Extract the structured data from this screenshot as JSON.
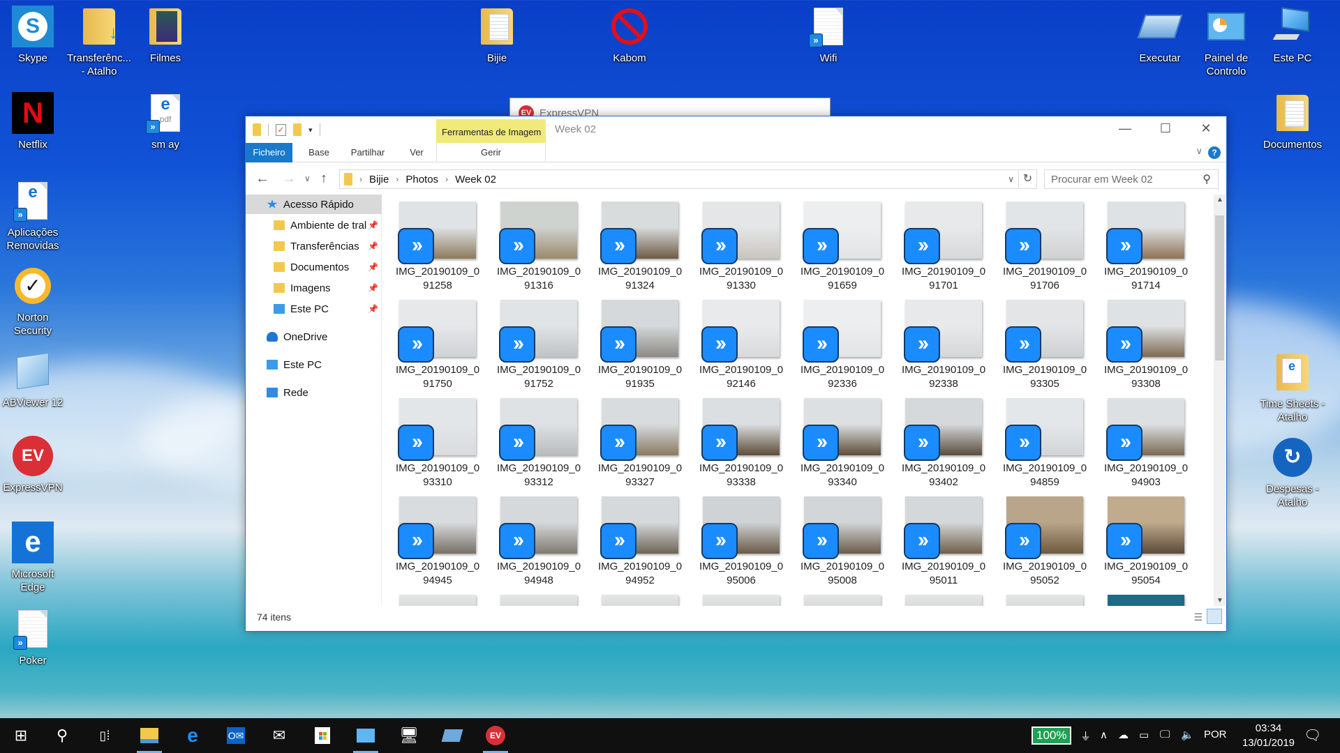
{
  "desktop": {
    "icons": [
      {
        "label": "Skype",
        "icon": "skype-icon"
      },
      {
        "label": "Transferênc... - Atalho",
        "icon": "downloads-folder-icon"
      },
      {
        "label": "Filmes",
        "icon": "videos-folder-icon"
      },
      {
        "label": "Bijie",
        "icon": "folder-icon"
      },
      {
        "label": "Kabom",
        "icon": "prohibited-icon"
      },
      {
        "label": "Wifi",
        "icon": "text-file-shortcut-icon"
      },
      {
        "label": "Executar",
        "icon": "run-icon"
      },
      {
        "label": "Painel de Controlo",
        "icon": "control-panel-icon"
      },
      {
        "label": "Este PC",
        "icon": "computer-icon"
      },
      {
        "label": "Netflix",
        "icon": "netflix-icon"
      },
      {
        "label": "sm ay",
        "icon": "pdf-shortcut-icon"
      },
      {
        "label": "Documentos",
        "icon": "documents-folder-icon"
      },
      {
        "label": "Aplicações Removidas",
        "icon": "edge-document-shortcut-icon"
      },
      {
        "label": "Norton Security",
        "icon": "norton-icon"
      },
      {
        "label": "ABViewer 12",
        "icon": "abviewer-icon"
      },
      {
        "label": "ExpressVPN",
        "icon": "expressvpn-icon"
      },
      {
        "label": "Microsoft Edge",
        "icon": "edge-icon"
      },
      {
        "label": "Poker",
        "icon": "text-file-shortcut-icon"
      },
      {
        "label": "Time Sheets - Atalho",
        "icon": "folder-shortcut-icon"
      },
      {
        "label": "Despesas - Atalho",
        "icon": "expenses-app-icon"
      }
    ]
  },
  "background_window": {
    "title": "ExpressVPN"
  },
  "explorer": {
    "title": "Week 02",
    "context_tab": "Ferramentas de Imagem",
    "context_subtab": "Gerir",
    "ribbon_tabs": [
      "Ficheiro",
      "Base",
      "Partilhar",
      "Ver"
    ],
    "breadcrumb": [
      "Bijie",
      "Photos",
      "Week 02"
    ],
    "search_placeholder": "Procurar em Week 02",
    "nav_pane": [
      {
        "label": "Acesso Rápido",
        "pinned": false,
        "selected": true
      },
      {
        "label": "Ambiente de tral",
        "pinned": true
      },
      {
        "label": "Transferências",
        "pinned": true
      },
      {
        "label": "Documentos",
        "pinned": true
      },
      {
        "label": "Imagens",
        "pinned": true
      },
      {
        "label": "Este PC",
        "pinned": true
      },
      {
        "label": "OneDrive"
      },
      {
        "label": "Este PC"
      },
      {
        "label": "Rede"
      }
    ],
    "files": [
      "IMG_20190109_091258",
      "IMG_20190109_091316",
      "IMG_20190109_091324",
      "IMG_20190109_091330",
      "IMG_20190109_091659",
      "IMG_20190109_091701",
      "IMG_20190109_091706",
      "IMG_20190109_091714",
      "IMG_20190109_091750",
      "IMG_20190109_091752",
      "IMG_20190109_091935",
      "IMG_20190109_092146",
      "IMG_20190109_092336",
      "IMG_20190109_092338",
      "IMG_20190109_093305",
      "IMG_20190109_093308",
      "IMG_20190109_093310",
      "IMG_20190109_093312",
      "IMG_20190109_093327",
      "IMG_20190109_093338",
      "IMG_20190109_093340",
      "IMG_20190109_093402",
      "IMG_20190109_094859",
      "IMG_20190109_094903",
      "IMG_20190109_094945",
      "IMG_20190109_094948",
      "IMG_20190109_094952",
      "IMG_20190109_095006",
      "IMG_20190109_095008",
      "IMG_20190109_095011",
      "IMG_20190109_095052",
      "IMG_20190109_095054"
    ],
    "status": "74 itens"
  },
  "taskbar": {
    "apps": [
      "start",
      "search",
      "task-view",
      "file-explorer",
      "edge",
      "outlook",
      "mail",
      "store",
      "control-panel",
      "this-pc",
      "run",
      "expressvpn"
    ],
    "battery": "100%",
    "language": "POR",
    "time": "03:34",
    "date": "13/01/2019"
  }
}
